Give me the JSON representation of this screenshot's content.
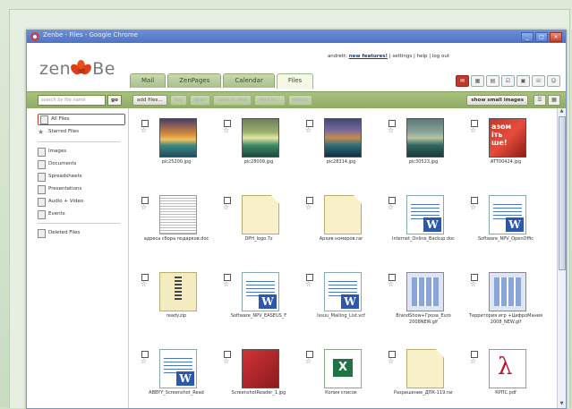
{
  "window": {
    "title": "Zenbe - Files - Google Chrome",
    "buttons": [
      "_",
      "□",
      "×"
    ]
  },
  "app": {
    "logo_left": "zen",
    "logo_right": "Be",
    "user_line_prefix": "andrett:",
    "new_features": "new features!",
    "user_line_suffix": "| settings | help | log out"
  },
  "tabs": [
    "Mail",
    "ZenPages",
    "Calendar",
    "Files"
  ],
  "active_tab": "Files",
  "toolbar": {
    "search_placeholder": "search by file name",
    "go": "go",
    "buttons": [
      "add files...",
      "tag",
      "open",
      "save to disk",
      "mail to...",
      "delete"
    ],
    "show_small": "show small images"
  },
  "sidebar": {
    "items": [
      {
        "label": "All Files",
        "icon": "file-icon",
        "selected": true
      },
      {
        "label": "Starred Files",
        "icon": "star-icon"
      },
      {
        "label": "Images",
        "icon": "image-icon"
      },
      {
        "label": "Documents",
        "icon": "document-icon"
      },
      {
        "label": "Spreadsheets",
        "icon": "spreadsheet-icon"
      },
      {
        "label": "Presentations",
        "icon": "presentation-icon"
      },
      {
        "label": "Audio + Video",
        "icon": "audio-video-icon"
      },
      {
        "label": "Events",
        "icon": "events-icon"
      },
      {
        "label": "Deleted Files",
        "icon": "trash-icon"
      }
    ]
  },
  "files": [
    {
      "name": "pic25200.jpg",
      "kind": "img1"
    },
    {
      "name": "pic28009.jpg",
      "kind": "img2"
    },
    {
      "name": "pic28314.jpg",
      "kind": "img3"
    },
    {
      "name": "pic30523.jpg",
      "kind": "img4"
    },
    {
      "name": "ATT00424.jpg",
      "kind": "img5",
      "thumb_text": "азом\nіть\nше!"
    },
    {
      "name": "адреса сбора подарков.doc",
      "kind": "scan"
    },
    {
      "name": "DPH_logo.7z",
      "kind": "doc"
    },
    {
      "name": "Архив номеров.rar",
      "kind": "doc"
    },
    {
      "name": "Internet_Online_Backup.doc",
      "kind": "word"
    },
    {
      "name": "Software_NPV_OpenOffic",
      "kind": "word"
    },
    {
      "name": "ready.zip",
      "kind": "zip"
    },
    {
      "name": "Software_NPV_EASEUS_F",
      "kind": "word"
    },
    {
      "name": "Issuu_Mailing_List.vcf",
      "kind": "word"
    },
    {
      "name": "BrandShow+Гроза_Euro 2008NEW.gif",
      "kind": "gif"
    },
    {
      "name": "Территория игр +ЦифроМания 2008_NEW.gif",
      "kind": "gif"
    },
    {
      "name": "ABBYY_Screenshot_Read",
      "kind": "word"
    },
    {
      "name": "ScreenshotReader_1.jpg",
      "kind": "redbook"
    },
    {
      "name": "Копия список",
      "kind": "excel"
    },
    {
      "name": "Разрешение_ДПК-119.rar",
      "kind": "doc"
    },
    {
      "name": "КРПС.pdf",
      "kind": "pdf"
    }
  ]
}
